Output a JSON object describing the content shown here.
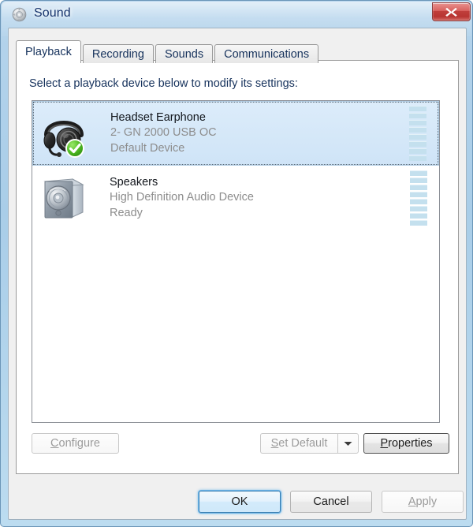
{
  "window": {
    "title": "Sound",
    "app_icon": "sound-speaker-icon",
    "close_label": "x",
    "accent_blue": "#3c7fb1",
    "titlebar_gradient_top": "#b5d4ec",
    "titlebar_gradient_bottom": "#bcdcf0"
  },
  "tabs": [
    {
      "label": "Playback",
      "active": true
    },
    {
      "label": "Recording",
      "active": false
    },
    {
      "label": "Sounds",
      "active": false
    },
    {
      "label": "Communications",
      "active": false
    }
  ],
  "panel": {
    "instruction": "Select a playback device below to modify its settings:"
  },
  "devices": [
    {
      "name": "Headset Earphone",
      "description": "2- GN 2000 USB OC",
      "status": "Default Device",
      "icon": "headset-icon",
      "selected": true,
      "is_default": true,
      "meter_segments": 8,
      "meter_color": "#c4e0ee"
    },
    {
      "name": "Speakers",
      "description": "High Definition Audio Device",
      "status": "Ready",
      "icon": "speaker-icon",
      "selected": false,
      "is_default": false,
      "meter_segments": 8,
      "meter_color": "#c4e0ee"
    }
  ],
  "actions": {
    "configure": {
      "label": "Configure",
      "accel": "C",
      "enabled": false
    },
    "set_default": {
      "label": "Set Default",
      "accel": "S",
      "enabled": false,
      "has_dropdown": true
    },
    "properties": {
      "label": "Properties",
      "accel": "P",
      "enabled": true
    }
  },
  "footer": {
    "ok": {
      "label": "OK",
      "enabled": true,
      "is_default": true
    },
    "cancel": {
      "label": "Cancel",
      "enabled": true,
      "is_default": false
    },
    "apply": {
      "label": "Apply",
      "accel": "A",
      "enabled": false,
      "is_default": false
    }
  }
}
